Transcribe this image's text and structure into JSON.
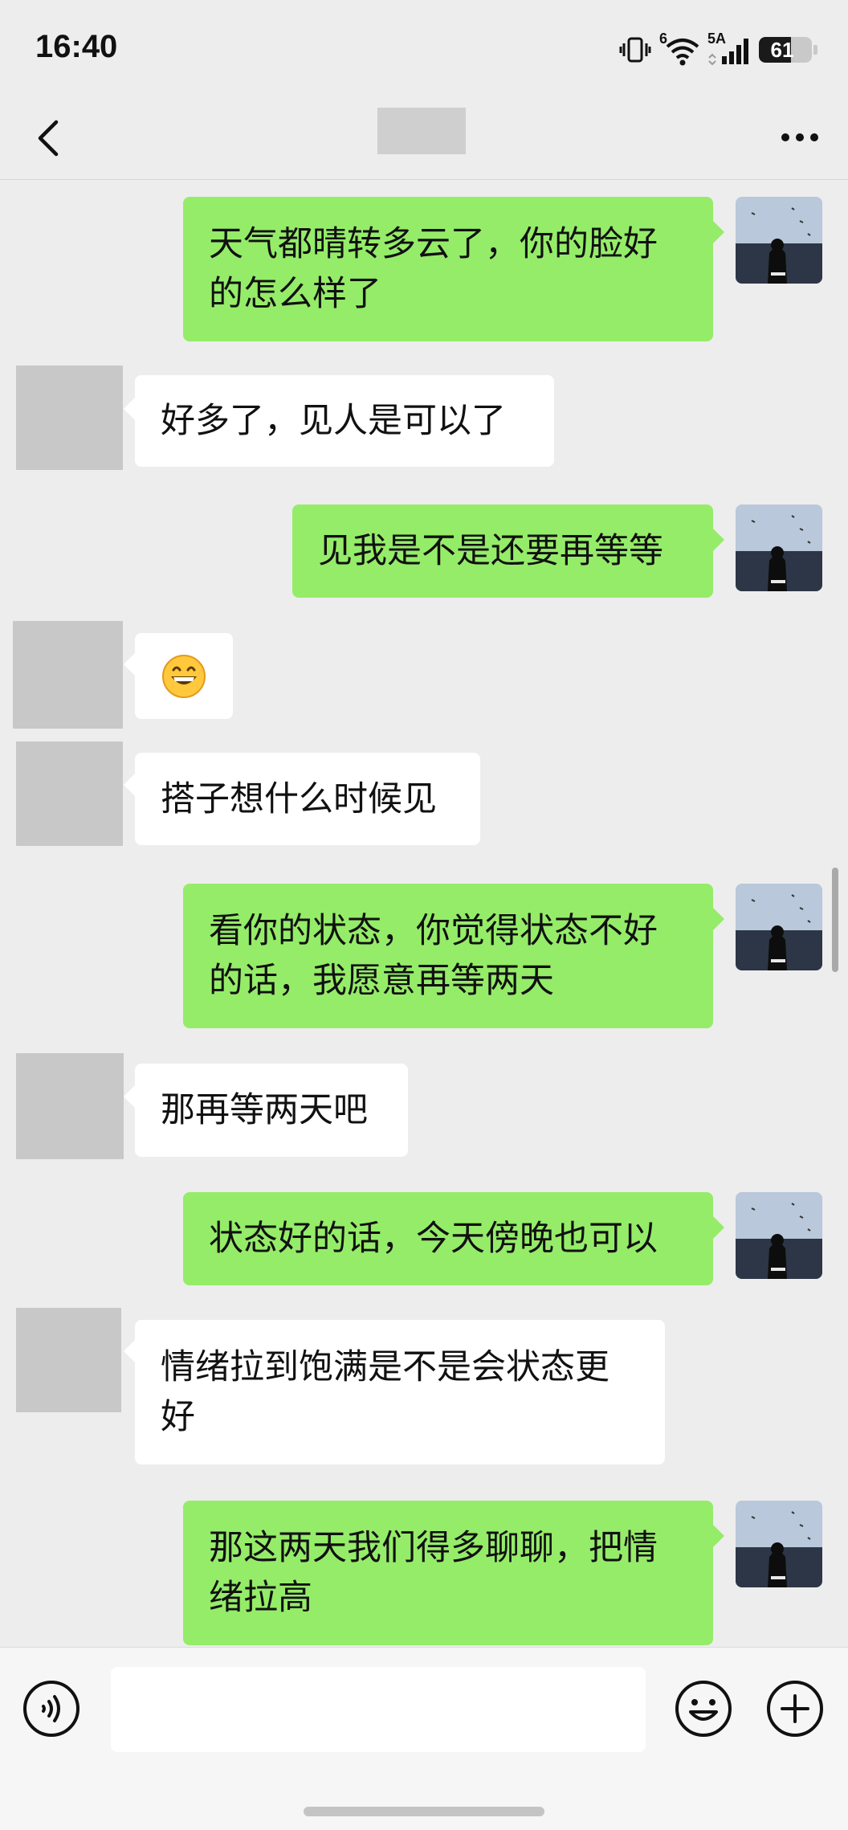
{
  "status_bar": {
    "time": "16:40",
    "network_label": "5A",
    "wifi_label": "6",
    "battery_level": 61,
    "battery_text": "61"
  },
  "header": {
    "back_icon": "chevron-left-icon",
    "more_icon": "ellipsis-icon"
  },
  "colors": {
    "outgoing_bubble": "#95ec69",
    "incoming_bubble": "#ffffff",
    "background": "#ededed"
  },
  "messages": [
    {
      "from": "me",
      "text": "天气都晴转多云了，你的脸好的怎么样了"
    },
    {
      "from": "other",
      "text": "好多了，见人是可以了"
    },
    {
      "from": "me",
      "text": "见我是不是还要再等等"
    },
    {
      "from": "other",
      "text": "😄",
      "emoji": "grinning-face"
    },
    {
      "from": "other",
      "text": "搭子想什么时候见"
    },
    {
      "from": "me",
      "text": "看你的状态，你觉得状态不好的话，我愿意再等两天"
    },
    {
      "from": "other",
      "text": "那再等两天吧"
    },
    {
      "from": "me",
      "text": "状态好的话，今天傍晚也可以"
    },
    {
      "from": "other",
      "text": "情绪拉到饱满是不是会状态更好"
    },
    {
      "from": "me",
      "text": "那这两天我们得多聊聊，把情绪拉高"
    }
  ],
  "input_bar": {
    "voice_icon": "voice-icon",
    "emoji_icon": "emoji-icon",
    "plus_icon": "plus-icon",
    "text_value": ""
  }
}
